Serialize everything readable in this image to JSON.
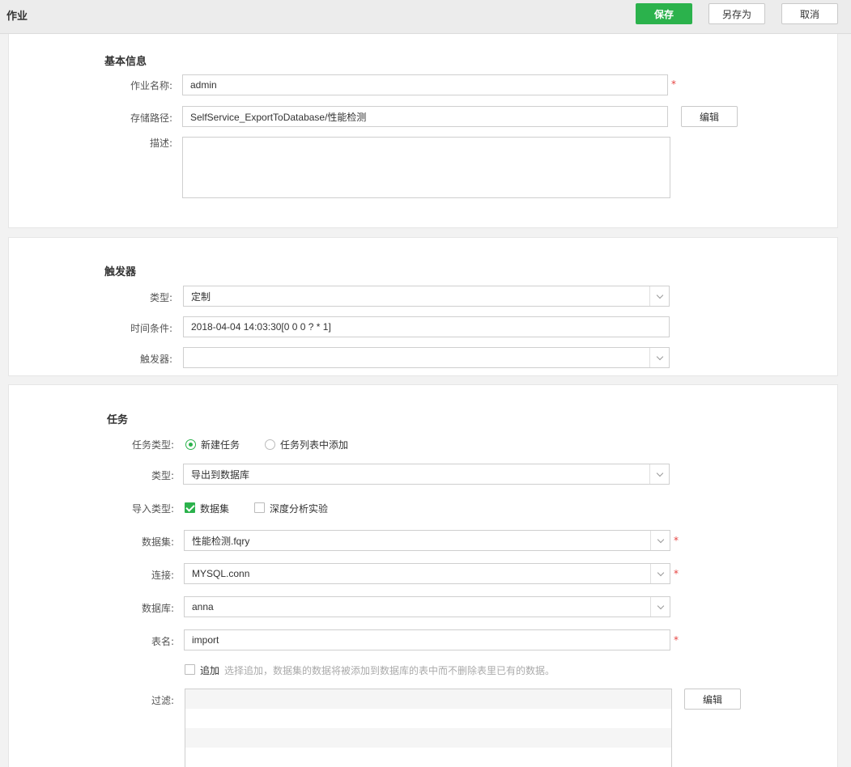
{
  "header": {
    "title": "作业",
    "save_label": "保存",
    "save_as_label": "另存为",
    "cancel_label": "取消",
    "accent_color": "#2bb24c"
  },
  "basic_info": {
    "title": "基本信息",
    "job_name_label": "作业名称:",
    "job_name_value": "admin",
    "storage_path_label": "存储路径:",
    "storage_path_value": "SelfService_ExportToDatabase/性能检测",
    "edit_label": "编辑",
    "description_label": "描述:",
    "required_mark": "*"
  },
  "trigger": {
    "title": "触发器",
    "type_label": "类型:",
    "type_value": "定制",
    "time_condition_label": "时间条件:",
    "time_condition_value": "2018-04-04 14:03:30[0 0 0 ? * 1]",
    "trigger_label": "触发器:",
    "trigger_value": ""
  },
  "task": {
    "title": "任务",
    "task_type_label": "任务类型:",
    "task_type_options": [
      "新建任务",
      "任务列表中添加"
    ],
    "task_type_selected": "新建任务",
    "type_label": "类型:",
    "type_value": "导出到数据库",
    "import_type_label": "导入类型:",
    "import_type_options": [
      "数据集",
      "深度分析实验"
    ],
    "import_type_checked": [
      "数据集"
    ],
    "dataset_label": "数据集:",
    "dataset_value": "性能检测.fqry",
    "connection_label": "连接:",
    "connection_value": "MYSQL.conn",
    "database_label": "数据库:",
    "database_value": "anna",
    "table_name_label": "表名:",
    "table_name_value": "import",
    "append_label": "追加",
    "append_checked": false,
    "append_hint": "选择追加，数据集的数据将被添加到数据库的表中而不删除表里已有的数据。",
    "filter_label": "过滤:",
    "edit_label": "编辑",
    "required_mark": "*"
  }
}
